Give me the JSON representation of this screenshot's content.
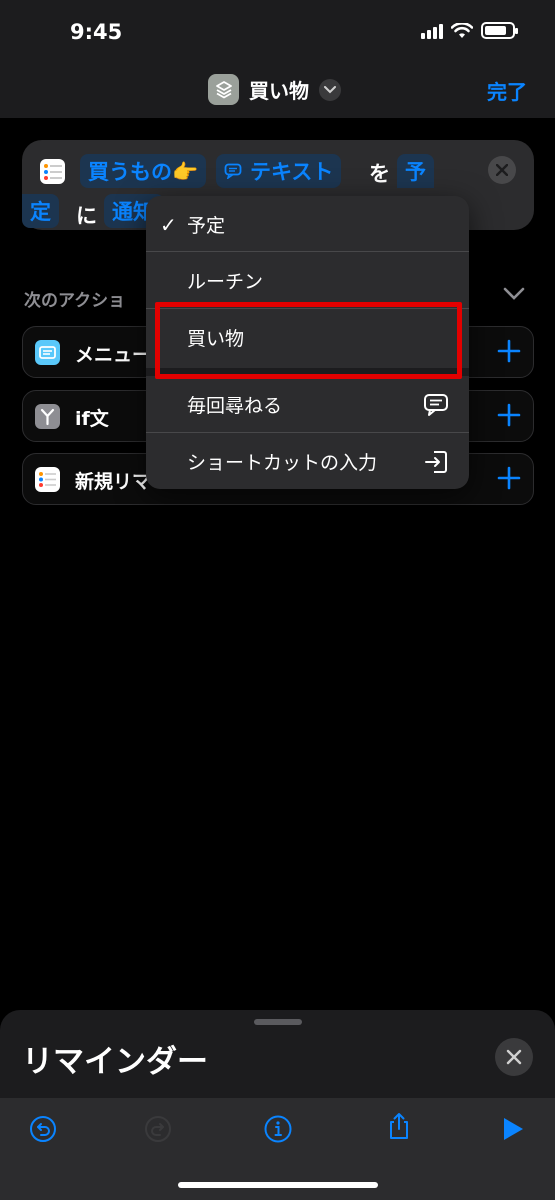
{
  "status": {
    "time": "9:45",
    "battery_level": 0.8
  },
  "nav": {
    "title": "買い物",
    "done_label": "完了"
  },
  "action": {
    "token_list": "買うもの👉",
    "token_text": "テキスト",
    "word_wo": "を",
    "token_calendar_1": "予",
    "token_calendar_2": "定",
    "word_ni": "に",
    "token_notify": "通知"
  },
  "next_actions": {
    "label": "次のアクショ",
    "items": [
      {
        "label": "メニュー"
      },
      {
        "label": "if文"
      },
      {
        "label": "新規リマ"
      }
    ]
  },
  "menu": {
    "items": [
      {
        "label": "予定",
        "checked": true
      },
      {
        "label": "ルーチン"
      },
      {
        "label": "買い物"
      },
      {
        "label": "毎回尋ねる",
        "icon": "message-icon"
      },
      {
        "label": "ショートカットの入力",
        "icon": "input-icon"
      }
    ]
  },
  "sheet": {
    "title": "リマインダー"
  },
  "colors": {
    "accent": "#0a84ff",
    "highlight": "#e30000"
  }
}
